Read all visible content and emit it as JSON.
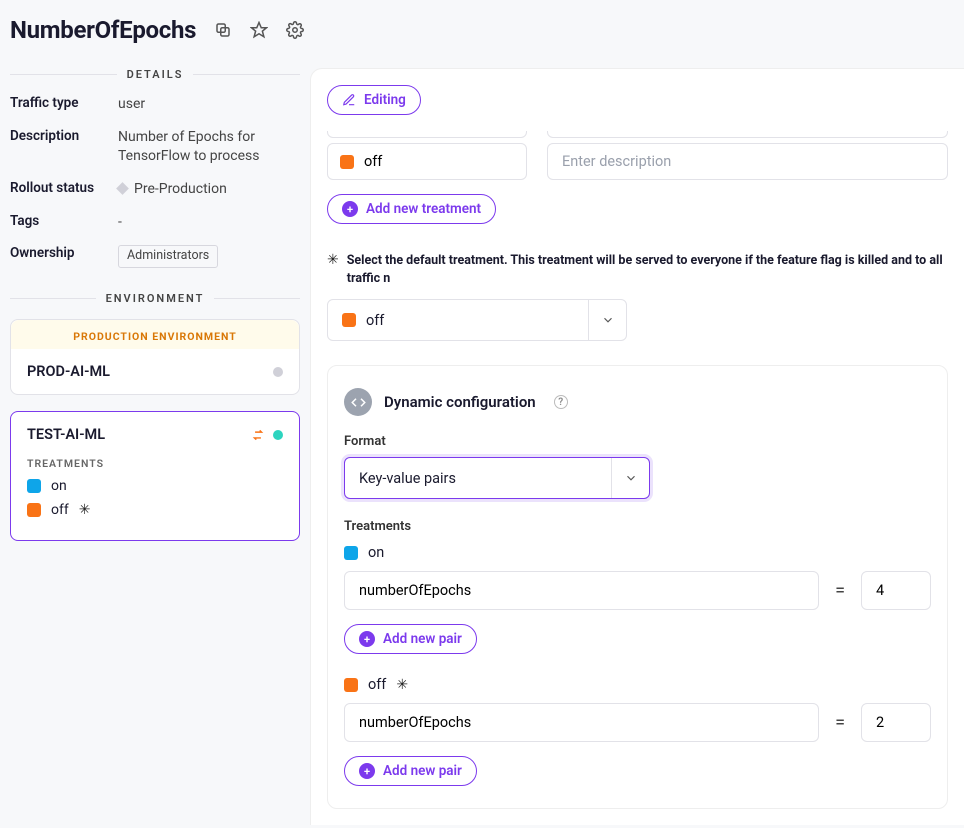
{
  "header": {
    "title": "NumberOfEpochs"
  },
  "side": {
    "details_label": "DETAILS",
    "traffic_type": {
      "k": "Traffic type",
      "v": "user"
    },
    "description": {
      "k": "Description",
      "v": "Number of Epochs for TensorFlow to process"
    },
    "rollout": {
      "k": "Rollout status",
      "v": "Pre-Production"
    },
    "tags": {
      "k": "Tags",
      "v": "-"
    },
    "ownership": {
      "k": "Ownership",
      "v": "Administrators"
    },
    "env_label": "ENVIRONMENT",
    "envs": {
      "prod": {
        "banner": "PRODUCTION ENVIRONMENT",
        "name": "PROD-AI-ML"
      },
      "test": {
        "name": "TEST-AI-ML",
        "treat_label": "TREATMENTS",
        "treatments": [
          {
            "bullet": "blue",
            "name": "on"
          },
          {
            "bullet": "orange",
            "name": "off",
            "star": true
          }
        ]
      }
    }
  },
  "main": {
    "editing": "Editing",
    "treatment_off": "off",
    "desc_placeholder": "Enter description",
    "add_treatment": "Add new treatment",
    "default_note": "Select the default treatment. This treatment will be served to everyone if the feature flag is killed and to all traffic n",
    "default_value": "off",
    "dyn": {
      "title": "Dynamic configuration",
      "format_label": "Format",
      "format_value": "Key-value pairs",
      "treatments_label": "Treatments",
      "on_label": "on",
      "off_label": "off",
      "add_pair": "Add new pair",
      "pairs": {
        "on": {
          "key": "numberOfEpochs",
          "val": "4"
        },
        "off": {
          "key": "numberOfEpochs",
          "val": "2"
        }
      }
    }
  }
}
